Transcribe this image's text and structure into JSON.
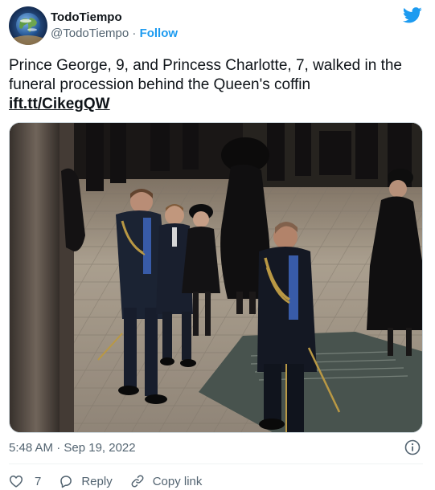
{
  "author": {
    "display_name": "TodoTiempo",
    "handle": "@TodoTiempo",
    "separator": " · ",
    "follow_label": "Follow",
    "avatar_icon": "globe-icon"
  },
  "tweet": {
    "text": "Prince George, 9, and Princess Charlotte, 7, walked in the funeral procession behind the Queen's coffin",
    "link": "ift.tt/CikegQW",
    "timestamp": "5:48 AM · Sep 19, 2022"
  },
  "actions": {
    "like_count": "7",
    "reply_label": "Reply",
    "copy_link_label": "Copy link"
  },
  "icons": {
    "brand": "twitter-bird-icon",
    "info": "info-icon",
    "like": "heart-icon",
    "reply": "reply-icon",
    "copy": "link-icon"
  },
  "colors": {
    "brand_blue": "#1d9bf0",
    "text": "#0f1419",
    "secondary": "#536471",
    "like_pink": "#f91880"
  }
}
